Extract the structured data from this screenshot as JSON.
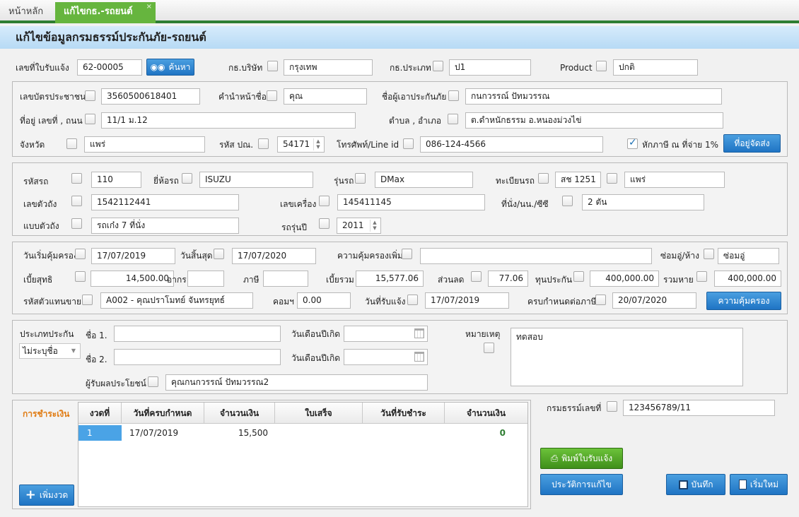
{
  "tabs": {
    "home": "หน้าหลัก",
    "active": "แก้ไขกธ.-รถยนต์",
    "close": "×"
  },
  "page_title": "แก้ไขข้อมูลกรมธรรม์ประกันภัย-รถยนต์",
  "top": {
    "receipt_label": "เลขที่ใบรับแจ้ง",
    "receipt_value": "62-00005",
    "search_label": "ค้นหา",
    "company_label": "กธ.บริษัท",
    "company_value": "กรุงเทพ",
    "type_label": "กธ.ประเภท",
    "type_value": "ป1",
    "product_label": "Product",
    "product_value": "ปกติ"
  },
  "customer": {
    "id_label": "เลขบัตรประชาชน",
    "id_value": "3560500618401",
    "prefix_label": "คำนำหน้าชื่อ",
    "prefix_value": "คุณ",
    "name_label": "ชื่อผู้เอาประกันภัย",
    "name_value": "กนกวรรณ์ ปัทมวรรณ",
    "address_label": "ที่อยู่ เลขที่ , ถนน",
    "address_value": "11/1 ม.12",
    "subdistrict_label": "ตำบล , อำเภอ",
    "subdistrict_value": "ต.ดำหนักธรรม อ.หนองม่วงไข่",
    "province_label": "จังหวัด",
    "province_value": "แพร่",
    "postcode_label": "รหัส ปณ.",
    "postcode_value": "54171",
    "phone_label": "โทรศัพท์/Line id",
    "phone_value": "086-124-4566",
    "tax_label": "หักภาษี ณ ที่จ่าย 1%",
    "shipping_button": "ที่อยู่จัดส่ง"
  },
  "vehicle": {
    "code_label": "รหัสรถ",
    "code_value": "110",
    "brand_label": "ยี่ห้อรถ",
    "brand_value": "ISUZU",
    "model_label": "รุ่นรถ",
    "model_value": "DMax",
    "plate_label": "ทะเบียนรถ",
    "plate_value": "สช 1251",
    "plate_province": "แพร่",
    "chassis_label": "เลขตัวถัง",
    "chassis_value": "1542112441",
    "engine_label": "เลขเครื่อง",
    "engine_value": "145411145",
    "seats_label": "ที่นั่ง/นน./ซีซี",
    "seats_value": "2 ตัน",
    "body_label": "แบบตัวถัง",
    "body_value": "รถเก๋ง 7 ที่นั่ง",
    "year_label": "รถรุ่นปี",
    "year_value": "2011"
  },
  "coverage": {
    "start_label": "วันเริ่มคุ้มครอง",
    "start_value": "17/07/2019",
    "end_label": "วันสิ้นสุด",
    "end_value": "17/07/2020",
    "extra_label": "ความคุ้มครองเพิ่ม",
    "extra_value": "",
    "repair_label": "ซ่อมอู่/ห้าง",
    "repair_value": "ซ่อมอู่",
    "net_label": "เบี้ยสุทธิ",
    "net_value": "14,500.00",
    "duty_label": "อากร",
    "duty_value": "",
    "tax_label": "ภาษี",
    "tax_value": "",
    "total_label": "เบี้ยรวม",
    "total_value": "15,577.06",
    "discount_label": "ส่วนลด",
    "discount_value": "77.06",
    "sum_label": "ทุนประกัน",
    "sum_value": "400,000.00",
    "loss_label": "รวมหาย",
    "loss_value": "400,000.00",
    "agent_label": "รหัสตัวแทนขาย",
    "agent_value": "A002 - คุณปราโมทย์ จันทรยุทธ์",
    "commission_label": "คอมฯ",
    "commission_value": "0.00",
    "received_label": "วันที่รับแจ้ง",
    "received_value": "17/07/2019",
    "due_label": "ครบกำหนดต่อภาษี",
    "due_value": "20/07/2020",
    "coverage_button": "ความคุ้มครอง"
  },
  "driver": {
    "type_label": "ประเภทประกัน",
    "type_value": "ไม่ระบุชื่อ",
    "name1_label": "ชื่อ 1.",
    "name1_value": "",
    "dob1_label": "วันเดือนปีเกิด",
    "dob1_value": "",
    "name2_label": "ชื่อ 2.",
    "name2_value": "",
    "dob2_label": "วันเดือนปีเกิด",
    "dob2_value": "",
    "beneficiary_label": "ผู้รับผลประโยชน์",
    "beneficiary_value": "คุณกนกวรรณ์ ปัทมวรรณ2",
    "note_label": "หมายเหตุ",
    "note_value": "ทดสอบ"
  },
  "payment": {
    "title": "การชำระเงิน",
    "add_button": "เพิ่มงวด",
    "columns": [
      "งวดที่",
      "วันที่ครบกำหนด",
      "จำนวนเงิน",
      "ใบเสร็จ",
      "วันที่รับชำระ",
      "จำนวนเงิน"
    ],
    "rows": [
      {
        "no": "1",
        "due": "17/07/2019",
        "amount": "15,500",
        "receipt": "",
        "paid_date": "",
        "paid": "0"
      }
    ]
  },
  "policy": {
    "label": "กรมธรรม์เลขที่",
    "value": "123456789/11"
  },
  "actions": {
    "print": "พิมพ์ใบรับแจ้ง",
    "history": "ประวัติการแก้ไข",
    "save": "บันทึก",
    "new": "เริ่มใหม่"
  },
  "colors": {
    "accent_green": "#2e7d32",
    "tab_green": "#66b53e",
    "header_blue": "#b7daf5",
    "button_blue": "#1f74c4",
    "payment_title": "#e07b12",
    "paid_value": "#2e7d32"
  }
}
